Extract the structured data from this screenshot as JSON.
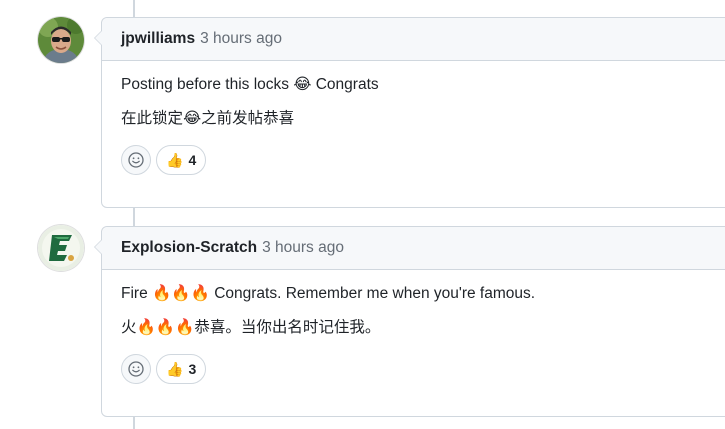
{
  "comments": [
    {
      "author": "jpwilliams",
      "time": "3 hours ago",
      "lines": [
        "Posting before this locks 😂 Congrats",
        "在此锁定😂之前发帖恭喜"
      ],
      "reaction_emoji": "👍",
      "reaction_count": "4",
      "avatar_icon": "person-avatar-icon"
    },
    {
      "author": "Explosion-Scratch",
      "time": "3 hours ago",
      "lines": [
        "Fire 🔥🔥🔥 Congrats. Remember me when you're famous.",
        "火🔥🔥🔥恭喜。当你出名时记住我。"
      ],
      "reaction_emoji": "👍",
      "reaction_count": "3",
      "avatar_icon": "letter-e-avatar-icon"
    }
  ],
  "colors": {
    "border": "#d0d7de",
    "header_bg": "#f6f8fa",
    "muted_text": "#656d76",
    "text": "#1f2328"
  }
}
